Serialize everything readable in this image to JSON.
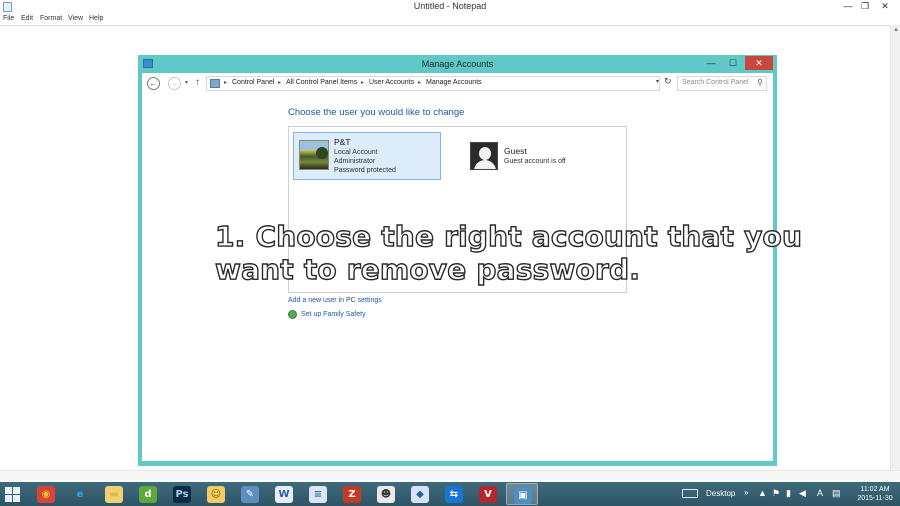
{
  "notepad": {
    "title": "Untitled - Notepad",
    "menu": [
      "File",
      "Edit",
      "Format",
      "View",
      "Help"
    ],
    "controls": {
      "minimize": "—",
      "maximize": "❐",
      "close": "✕"
    }
  },
  "manage_accounts": {
    "title": "Manage Accounts",
    "breadcrumb": [
      "Control Panel",
      "All Control Panel Items",
      "User Accounts",
      "Manage Accounts"
    ],
    "search_placeholder": "Search Control Panel",
    "heading": "Choose the user you would like to change",
    "accounts": [
      {
        "name": "P&T",
        "lines": [
          "Local Account",
          "Administrator",
          "Password protected"
        ],
        "selected": true
      },
      {
        "name": "Guest",
        "lines": [
          "Guest account is off"
        ],
        "selected": false
      }
    ],
    "links": {
      "add_user": "Add a new user in PC settings",
      "family_safety": "Set up Family Safety"
    }
  },
  "overlay": {
    "line1": "1. Choose the right account that you",
    "line2": "want to remove password."
  },
  "taskbar": {
    "apps": [
      {
        "name": "chrome-icon",
        "glyph": "◉",
        "color": "#f2c230",
        "bg": "#d94436"
      },
      {
        "name": "internet-explorer-icon",
        "glyph": "e",
        "color": "#3ba1e4",
        "bg": "transparent"
      },
      {
        "name": "file-explorer-icon",
        "glyph": "▬",
        "color": "#e5b640",
        "bg": "#f0d070"
      },
      {
        "name": "dreamweaver-icon",
        "glyph": "d",
        "color": "#ffffff",
        "bg": "#5aa93a"
      },
      {
        "name": "photoshop-icon",
        "glyph": "Ps",
        "color": "#9fd0f5",
        "bg": "#0c2a45"
      },
      {
        "name": "user-folder-icon",
        "glyph": "☺",
        "color": "#8a5a00",
        "bg": "#f3cc63"
      },
      {
        "name": "pen-tool-icon",
        "glyph": "✎",
        "color": "#ffffff",
        "bg": "#5b8fbd"
      },
      {
        "name": "word-icon",
        "glyph": "W",
        "color": "#2a5faa",
        "bg": "#e8eef8"
      },
      {
        "name": "document-icon",
        "glyph": "≡",
        "color": "#3a6aa5",
        "bg": "#dce6f2"
      },
      {
        "name": "filezilla-icon",
        "glyph": "Z",
        "color": "#ffffff",
        "bg": "#c23b22"
      },
      {
        "name": "remote-assist-icon",
        "glyph": "☻",
        "color": "#333333",
        "bg": "#e9e9e9"
      },
      {
        "name": "network-tool-icon",
        "glyph": "◆",
        "color": "#1d5fa8",
        "bg": "#d7e3f1"
      },
      {
        "name": "teamviewer-icon",
        "glyph": "⇆",
        "color": "#ffffff",
        "bg": "#1a74d4"
      },
      {
        "name": "vnc-icon",
        "glyph": "V",
        "color": "#ffffff",
        "bg": "#b3282d"
      },
      {
        "name": "control-panel-icon",
        "glyph": "▣",
        "color": "#ffffff",
        "bg": "#4f8fc0"
      }
    ],
    "tray": {
      "desktop_label": "Desktop",
      "chevron": "»",
      "ime": "A",
      "time": "11:02 AM",
      "date": "2015-11-30"
    }
  }
}
